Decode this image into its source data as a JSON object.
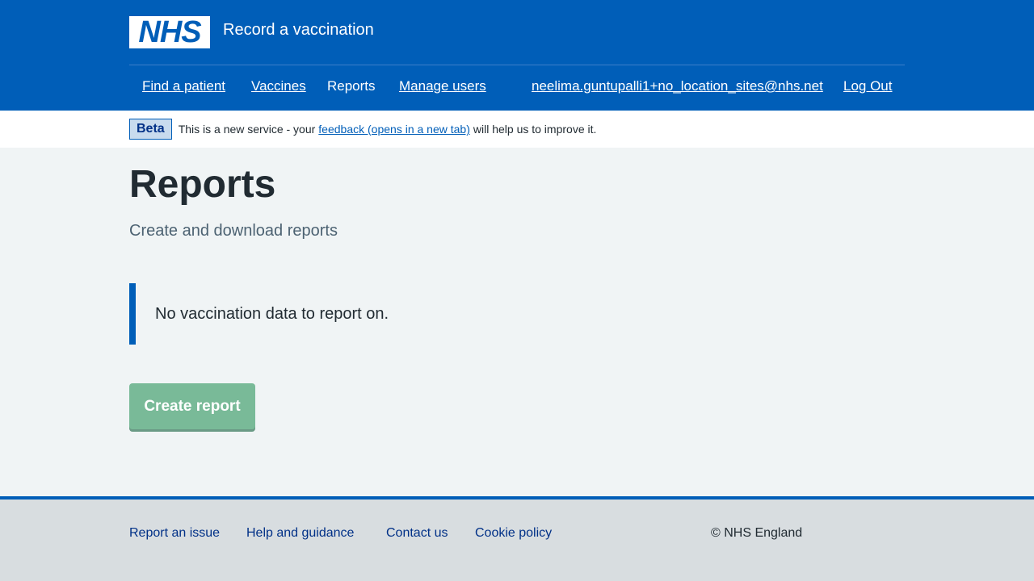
{
  "header": {
    "logo_text": "NHS",
    "service_name": "Record a vaccination",
    "nav": {
      "find_patient": "Find a patient",
      "vaccines": "Vaccines",
      "reports": "Reports",
      "manage_users": "Manage users",
      "user_email": "neelima.guntupalli1+no_location_sites@nhs.net",
      "log_out": "Log Out"
    }
  },
  "phase_banner": {
    "tag": "Beta",
    "text_before": "This is a new service - your",
    "link": "feedback (opens in a new tab)",
    "text_after": "will help us to improve it."
  },
  "main": {
    "title": "Reports",
    "subtitle": "Create and download reports",
    "inset_text": "No vaccination data to report on.",
    "create_button": "Create report"
  },
  "footer": {
    "links": [
      "Report an issue",
      "Help and guidance",
      "Contact us",
      "Cookie policy"
    ],
    "copyright": "© NHS England"
  },
  "colors": {
    "brand_blue": "#005eb8",
    "button_disabled_green": "#79ba98",
    "page_background": "#f0f4f5",
    "footer_background": "#d8dde0"
  }
}
